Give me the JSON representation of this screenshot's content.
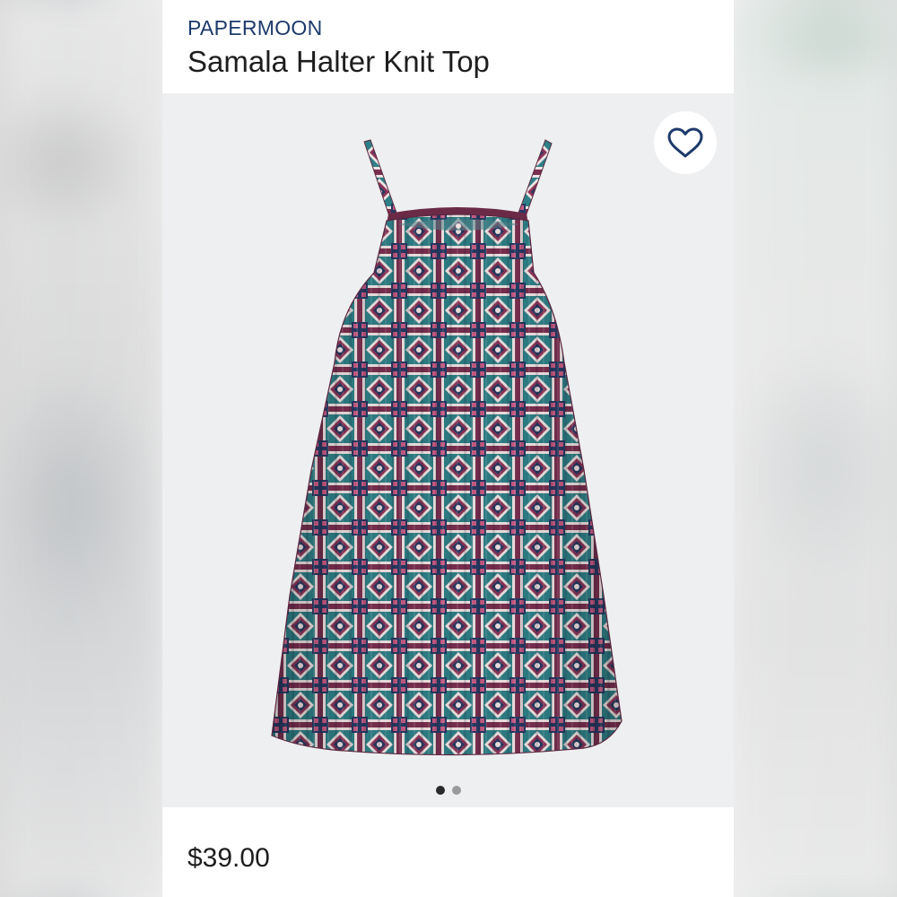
{
  "product": {
    "brand": "PAPERMOON",
    "name": "Samala Halter Knit Top",
    "price": "$39.00"
  },
  "gallery": {
    "image_count": 2,
    "active_index": 0
  },
  "icons": {
    "favorite": "heart-outline-icon"
  },
  "colors": {
    "brand_text": "#1d3a6b",
    "heart": "#1d3a6b",
    "image_background": "#eeeff0",
    "print_plum": "#7a2f4f",
    "print_teal": "#2e7f86",
    "print_navy": "#273a63",
    "print_cream": "#efe3e3"
  }
}
